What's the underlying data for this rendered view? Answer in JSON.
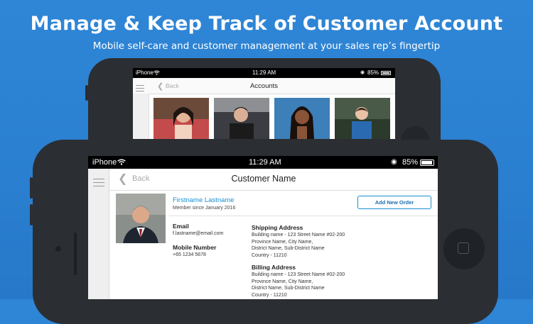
{
  "hero": {
    "title": "Manage & Keep Track of Customer Account",
    "subtitle": "Mobile self-care and customer management at your sales rep’s fingertip"
  },
  "back_device": {
    "status": {
      "carrier": "iPhone",
      "time": "11:29 AM",
      "battery": "85%"
    },
    "nav": {
      "back_label": "Back",
      "title": "Accounts"
    }
  },
  "front_device": {
    "status": {
      "carrier": "iPhone",
      "time": "11:29 AM",
      "battery": "85%"
    },
    "nav": {
      "back_label": "Back",
      "title": "Customer Name"
    },
    "profile": {
      "name": "Firstname Lastname",
      "member_since": "Member since January 2016",
      "add_order_button": "Add New Order"
    },
    "contact": {
      "email_label": "Email",
      "email": "f.lastname@email.com",
      "mobile_label": "Mobile Number",
      "mobile": "+65 1234 5678"
    },
    "shipping": {
      "label": "Shipping Address",
      "lines": [
        "Building name - 123 Street Name #02-200",
        "Province Name, City Name,",
        "District Name, Sub-District Name",
        "Country - 11210"
      ]
    },
    "billing": {
      "label": "Billing Address",
      "lines": [
        "Building name - 123 Street Name #02-200",
        "Province Name, City Name,",
        "District Name, Sub-District Name",
        "Country - 11210"
      ]
    }
  },
  "colors": {
    "background": "#2f86d6",
    "accent": "#1a8fd0",
    "device": "#2b2e33"
  }
}
